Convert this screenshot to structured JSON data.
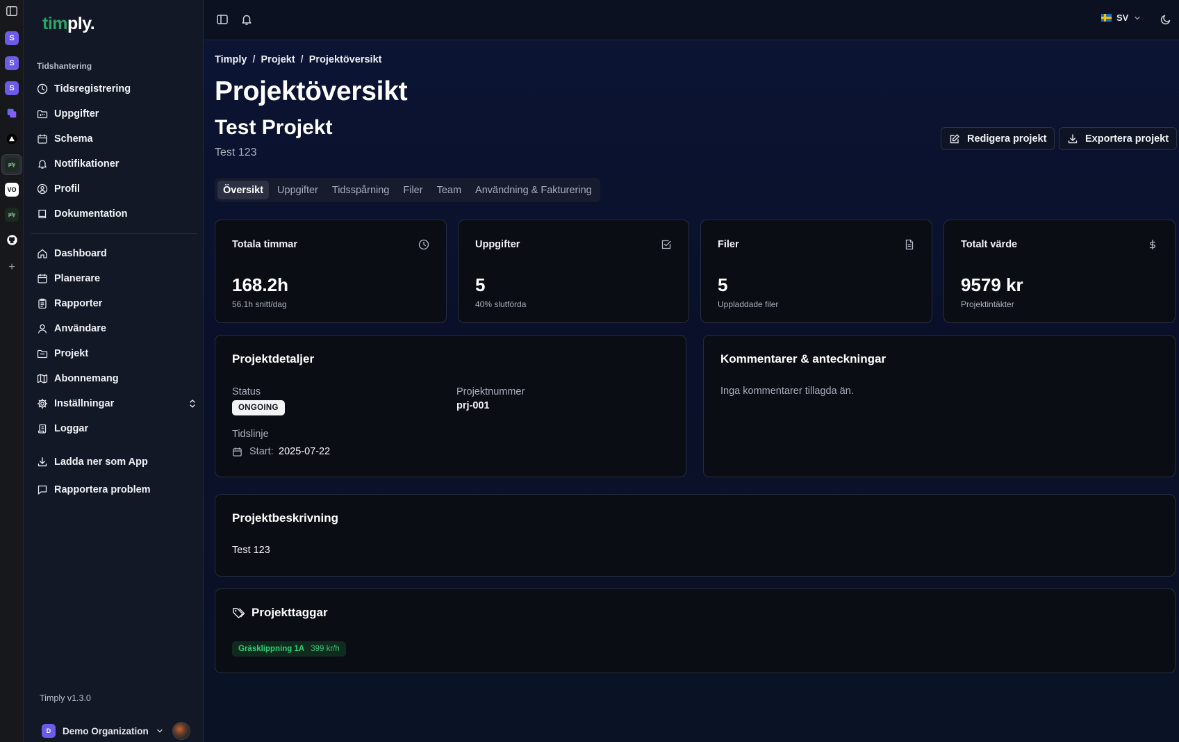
{
  "app": {
    "logo_part1": "tim",
    "logo_part2": "ply.",
    "version": "Timply v1.3.0",
    "organization": "Demo Organization",
    "org_initial": "D",
    "accent_color": "#2aa565"
  },
  "strip": {
    "items": [
      {
        "icon": "sidebar-toggle-icon"
      },
      {
        "icon": "s-app-icon",
        "letter": "S",
        "color": "#6b5ce7"
      },
      {
        "icon": "s-app-icon",
        "letter": "S",
        "color": "#6b5ce7"
      },
      {
        "icon": "s-app-icon",
        "letter": "S",
        "color": "#6b5ce7"
      },
      {
        "icon": "copy-app-icon"
      },
      {
        "icon": "triangle-app-icon"
      },
      {
        "icon": "timply-app-icon"
      },
      {
        "icon": "vo-app-icon",
        "letter": "VO"
      },
      {
        "icon": "timply-app-icon"
      },
      {
        "icon": "github-icon"
      },
      {
        "icon": "plus-icon",
        "letter": "+"
      }
    ]
  },
  "sidebar": {
    "section_label": "Tidshantering",
    "group1": [
      {
        "label": "Tidsregistrering",
        "icon": "clock-icon"
      },
      {
        "label": "Uppgifter",
        "icon": "folder-kanban-icon"
      },
      {
        "label": "Schema",
        "icon": "calendar-icon"
      },
      {
        "label": "Notifikationer",
        "icon": "bell-icon"
      },
      {
        "label": "Profil",
        "icon": "user-circle-icon"
      },
      {
        "label": "Dokumentation",
        "icon": "book-icon"
      }
    ],
    "group2": [
      {
        "label": "Dashboard",
        "icon": "home-icon"
      },
      {
        "label": "Planerare",
        "icon": "calendar-icon"
      },
      {
        "label": "Rapporter",
        "icon": "clipboard-icon"
      },
      {
        "label": "Användare",
        "icon": "user-icon"
      },
      {
        "label": "Projekt",
        "icon": "folder-icon"
      },
      {
        "label": "Abonnemang",
        "icon": "map-icon"
      },
      {
        "label": "Inställningar",
        "icon": "gear-icon"
      },
      {
        "label": "Loggar",
        "icon": "logs-icon"
      }
    ],
    "group3": [
      {
        "label": "Ladda ner som App",
        "icon": "download-icon"
      },
      {
        "label": "Rapportera problem",
        "icon": "message-icon"
      }
    ]
  },
  "topbar": {
    "language": "SV"
  },
  "breadcrumb": [
    "Timply",
    "Projekt",
    "Projektöversikt"
  ],
  "breadcrumb_sep": "/",
  "page_title": "Projektöversikt",
  "project": {
    "name": "Test Projekt",
    "subtitle": "Test 123",
    "edit_label": "Redigera projekt",
    "export_label": "Exportera projekt"
  },
  "tabs": [
    {
      "label": "Översikt",
      "active": true
    },
    {
      "label": "Uppgifter"
    },
    {
      "label": "Tidsspårning"
    },
    {
      "label": "Filer"
    },
    {
      "label": "Team"
    },
    {
      "label": "Användning & Fakturering"
    }
  ],
  "stats": [
    {
      "title": "Totala timmar",
      "value": "168.2h",
      "sub": "56.1h snitt/dag",
      "icon": "clock-icon"
    },
    {
      "title": "Uppgifter",
      "value": "5",
      "sub": "40% slutförda",
      "icon": "check-square-icon"
    },
    {
      "title": "Filer",
      "value": "5",
      "sub": "Uppladdade filer",
      "icon": "file-icon"
    },
    {
      "title": "Totalt värde",
      "value": "9579 kr",
      "sub": "Projektintäkter",
      "icon": "dollar-icon"
    }
  ],
  "details": {
    "title": "Projektdetaljer",
    "status_label": "Status",
    "status_value": "ONGOING",
    "number_label": "Projektnummer",
    "number_value": "prj-001",
    "timeline_label": "Tidslinje",
    "start_label": "Start:",
    "start_value": "2025-07-22"
  },
  "comments": {
    "title": "Kommentarer & anteckningar",
    "empty": "Inga kommentarer tillagda än."
  },
  "description": {
    "title": "Projektbeskrivning",
    "text": "Test 123"
  },
  "tags": {
    "title": "Projekttaggar",
    "items": [
      {
        "name": "Gräsklippning 1A",
        "price": "399 kr/h"
      }
    ]
  }
}
